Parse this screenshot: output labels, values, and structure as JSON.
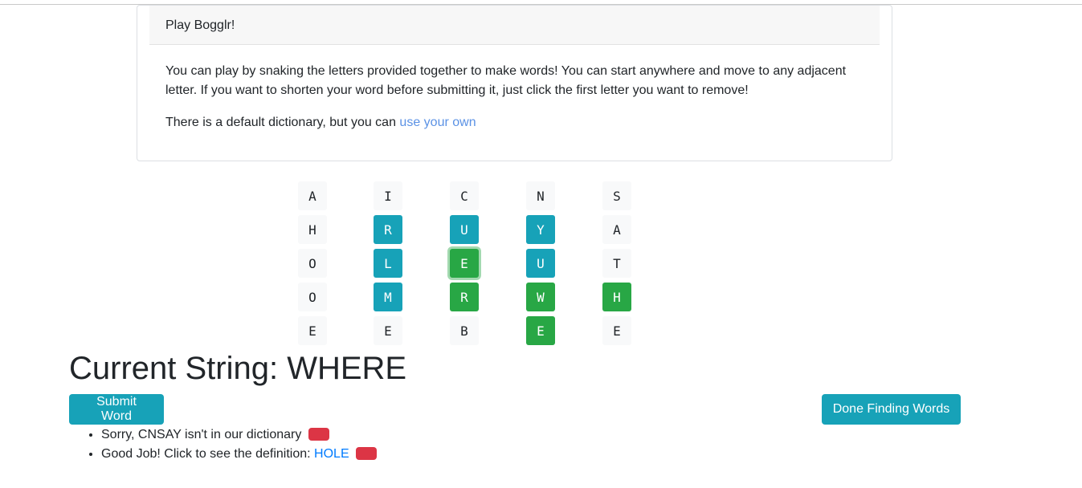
{
  "header": {
    "title": "Play Bogglr!"
  },
  "intro": {
    "paragraph1": "You can play by snaking the letters provided together to make words! You can start anywhere and move to any adjacent letter. If you want to shorten your word before submitting it, just click the first letter you want to remove!",
    "paragraph2_prefix": "There is a default dictionary, but you can ",
    "paragraph2_link": "use your own"
  },
  "board": {
    "rows": [
      [
        {
          "letter": "A",
          "state": "default"
        },
        {
          "letter": "I",
          "state": "default"
        },
        {
          "letter": "C",
          "state": "default"
        },
        {
          "letter": "N",
          "state": "default"
        },
        {
          "letter": "S",
          "state": "default"
        }
      ],
      [
        {
          "letter": "H",
          "state": "default"
        },
        {
          "letter": "R",
          "state": "adjacent"
        },
        {
          "letter": "U",
          "state": "adjacent"
        },
        {
          "letter": "Y",
          "state": "adjacent"
        },
        {
          "letter": "A",
          "state": "default"
        }
      ],
      [
        {
          "letter": "O",
          "state": "default"
        },
        {
          "letter": "L",
          "state": "adjacent"
        },
        {
          "letter": "E",
          "state": "selected-last"
        },
        {
          "letter": "U",
          "state": "adjacent"
        },
        {
          "letter": "T",
          "state": "default"
        }
      ],
      [
        {
          "letter": "O",
          "state": "default"
        },
        {
          "letter": "M",
          "state": "adjacent"
        },
        {
          "letter": "R",
          "state": "selected"
        },
        {
          "letter": "W",
          "state": "selected"
        },
        {
          "letter": "H",
          "state": "selected"
        }
      ],
      [
        {
          "letter": "E",
          "state": "default"
        },
        {
          "letter": "E",
          "state": "default"
        },
        {
          "letter": "B",
          "state": "default"
        },
        {
          "letter": "E",
          "state": "selected"
        },
        {
          "letter": "E",
          "state": "default"
        }
      ]
    ]
  },
  "current": {
    "label": "Current String: WHERE"
  },
  "buttons": {
    "submit": "Submit Word",
    "done": "Done Finding Words"
  },
  "messages": [
    {
      "text": "Sorry, CNSAY isn't in our dictionary",
      "link": ""
    },
    {
      "text": "Good Job! Click to see the definition: ",
      "link": "HOLE"
    }
  ],
  "colors": {
    "default": "#f8f9fa",
    "adjacent": "#17a2b8",
    "selected": "#28a745",
    "danger": "#dc3545",
    "link": "#007bff"
  }
}
